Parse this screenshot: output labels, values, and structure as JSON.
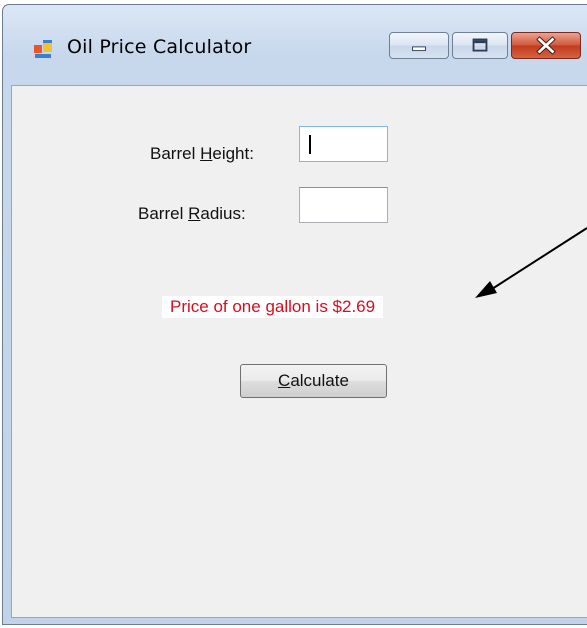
{
  "window": {
    "title": "Oil Price Calculator",
    "icon": "form-icon"
  },
  "controls": {
    "minimize_icon": "minimize-icon",
    "maximize_icon": "maximize-icon",
    "close_icon": "close-icon"
  },
  "form": {
    "height_label_pre": "Barrel ",
    "height_label_key": "H",
    "height_label_post": "eight:",
    "height_value": "",
    "radius_label_pre": "Barrel ",
    "radius_label_key": "R",
    "radius_label_post": "adius:",
    "radius_value": "",
    "result_text": "Price of one gallon is $2.69",
    "calculate_key": "C",
    "calculate_rest": "alculate"
  },
  "colors": {
    "result_text": "#d50f1f",
    "client_bg": "#f0f0f0",
    "close_button": "#c13b1f"
  }
}
